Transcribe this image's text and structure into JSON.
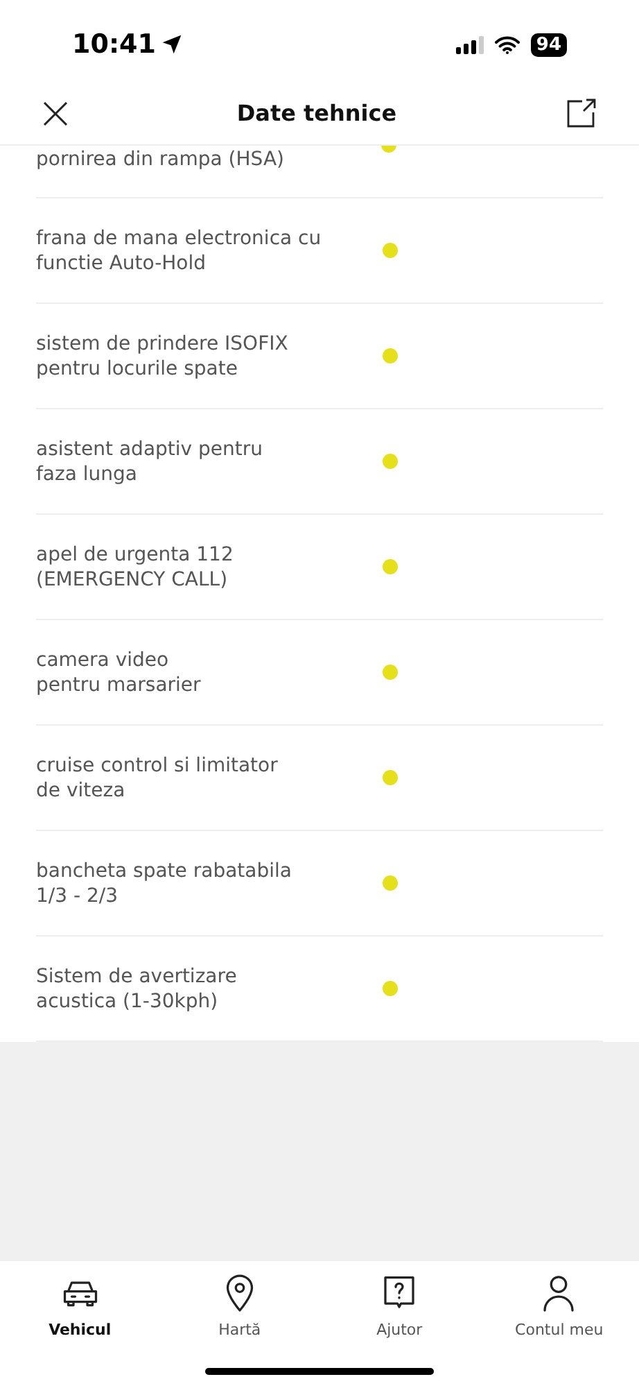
{
  "status_bar": {
    "time": "10:41",
    "battery": "94"
  },
  "header": {
    "title": "Date tehnice"
  },
  "features": [
    {
      "label": "pornirea din rampa (HSA)",
      "available": true,
      "partial": true
    },
    {
      "label": "frana de mana electronica cu\nfunctie Auto-Hold",
      "available": true,
      "partial": false
    },
    {
      "label": "sistem de prindere ISOFIX\npentru locurile spate",
      "available": true,
      "partial": false
    },
    {
      "label": "asistent adaptiv pentru\nfaza lunga",
      "available": true,
      "partial": false
    },
    {
      "label": "apel de urgenta 112\n(EMERGENCY CALL)",
      "available": true,
      "partial": false
    },
    {
      "label": "camera video\npentru marsarier",
      "available": true,
      "partial": false
    },
    {
      "label": "cruise control si limitator\nde viteza",
      "available": true,
      "partial": false
    },
    {
      "label": "bancheta spate rabatabila\n1/3 - 2/3",
      "available": true,
      "partial": false
    },
    {
      "label": "Sistem de avertizare\nacustica (1-30kph)",
      "available": true,
      "partial": false
    }
  ],
  "nav": [
    {
      "kind": "car",
      "label": "Vehicul",
      "selected": true
    },
    {
      "kind": "pin",
      "label": "Hartă",
      "selected": false
    },
    {
      "kind": "help",
      "label": "Ajutor",
      "selected": false
    },
    {
      "kind": "person",
      "label": "Contul meu",
      "selected": false
    }
  ]
}
